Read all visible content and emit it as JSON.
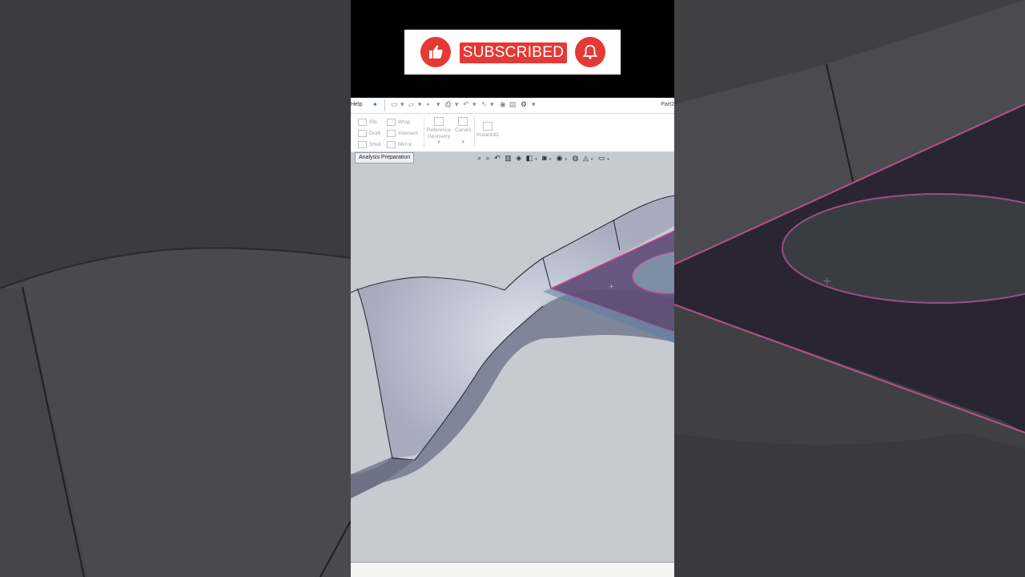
{
  "banner": {
    "subscribed_label": "SUBSCRIBED",
    "like_icon": "thumbs-up-icon",
    "bell_icon": "bell-icon",
    "accent_color": "#e53935"
  },
  "quick_access": {
    "menu_help": "Help",
    "pin_icon": "pin-icon",
    "document_title": "Part2"
  },
  "ribbon": {
    "features": [
      "Rib",
      "Draft",
      "Shell",
      "Wrap",
      "Intersect",
      "Mirror"
    ],
    "reference_geometry": [
      "Reference",
      "Geometry"
    ],
    "curves": "Curves",
    "instant3d": "Instant3D"
  },
  "command_tabs": {
    "active": "Analysis Preparation"
  },
  "viewport": {
    "background_color": "#c6cbd2",
    "part_color": "#a9afc0",
    "selected_face_color": "#6e5a86",
    "highlight_edge_color": "#e03e9a"
  }
}
